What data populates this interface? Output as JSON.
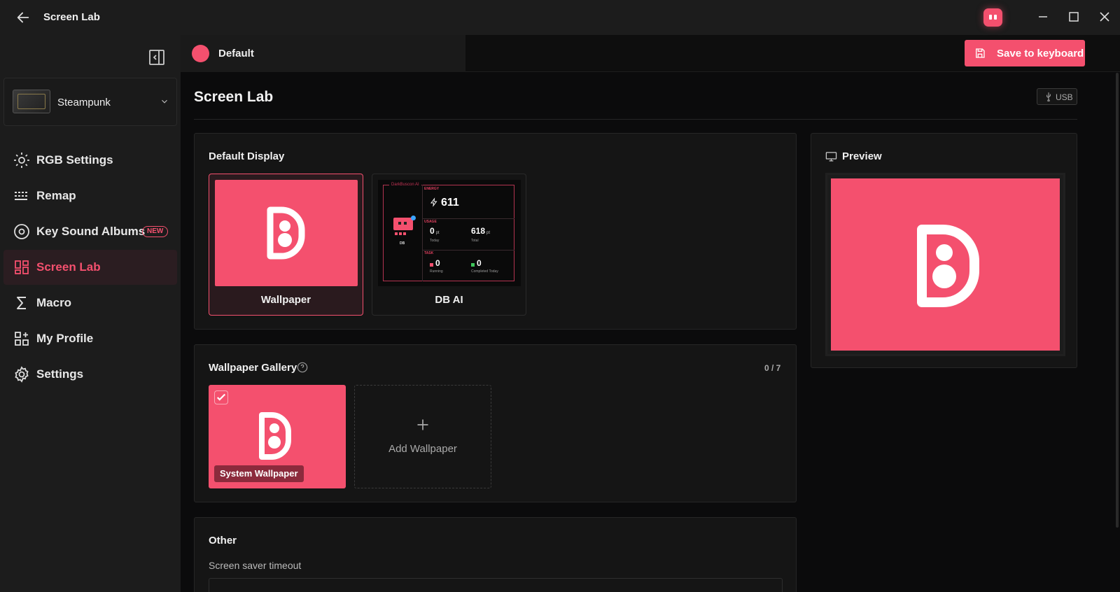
{
  "window": {
    "title": "Screen Lab"
  },
  "colors": {
    "accent": "#f4506e",
    "background": "#0b0b0c",
    "sidebar": "#1c1c1c"
  },
  "sidebar": {
    "device": {
      "name": "Steampunk"
    },
    "items": [
      {
        "label": "RGB Settings",
        "icon": "sun-icon"
      },
      {
        "label": "Remap",
        "icon": "keyboard-icon"
      },
      {
        "label": "Key Sound Albums",
        "icon": "disc-icon",
        "badge": "NEW"
      },
      {
        "label": "Screen Lab",
        "icon": "grid-icon",
        "active": true
      },
      {
        "label": "Macro",
        "icon": "sigma-icon"
      },
      {
        "label": "My Profile",
        "icon": "profile-icon"
      },
      {
        "label": "Settings",
        "icon": "gear-icon"
      }
    ]
  },
  "topbar": {
    "profile_name": "Default",
    "save_label": "Save to keyboard"
  },
  "page": {
    "title": "Screen Lab",
    "connection": "USB"
  },
  "default_display": {
    "title": "Default Display",
    "options": [
      {
        "label": "Wallpaper",
        "selected": true
      },
      {
        "label": "DB AI",
        "selected": false
      }
    ],
    "dbai": {
      "brand": "DarkBuscon AI",
      "robot_label": "DB",
      "energy_caption": "ENERGY",
      "energy_value": "611",
      "usage_caption": "USAGE",
      "today_value": "0",
      "today_unit": "pt",
      "today_label": "Today",
      "total_value": "618",
      "total_unit": "pt",
      "total_label": "Total",
      "task_caption": "TASK",
      "running_value": "0",
      "running_label": "Running",
      "completed_value": "0",
      "completed_label": "Completed Today"
    }
  },
  "gallery": {
    "title": "Wallpaper Gallery",
    "count": "0 / 7",
    "items": [
      {
        "label": "System Wallpaper",
        "checked": true
      }
    ],
    "add_label": "Add Wallpaper"
  },
  "other": {
    "title": "Other",
    "screensaver_label": "Screen saver timeout"
  },
  "preview": {
    "title": "Preview"
  }
}
